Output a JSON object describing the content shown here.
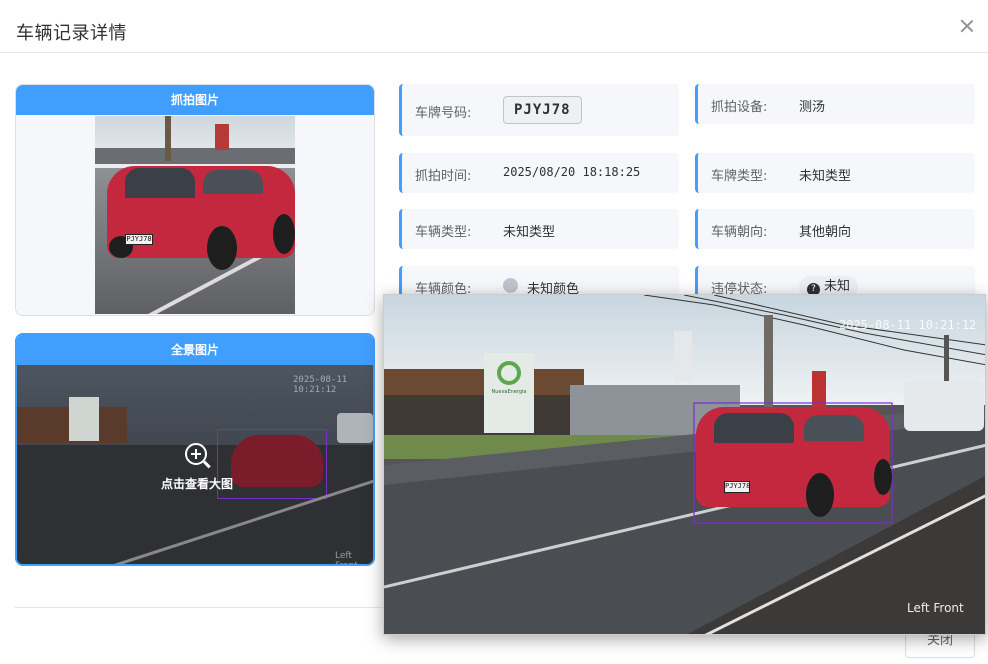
{
  "dialog": {
    "title": "车辆记录详情",
    "close_label": "关闭"
  },
  "capture_card": {
    "title": "抓拍图片",
    "plate_text": "PJYJ78"
  },
  "full_card": {
    "title": "全景图片",
    "zoom_hint": "点击查看大图",
    "timestamp": "2025-08-11 10:21:12",
    "caption": "Left Front"
  },
  "info": {
    "plate": {
      "label": "车牌号码:",
      "value": "PJYJ78"
    },
    "device": {
      "label": "抓拍设备:",
      "value": "测汤"
    },
    "time": {
      "label": "抓拍时间:",
      "value": "2025/08/20 18:18:25"
    },
    "plate_type": {
      "label": "车牌类型:",
      "value": "未知类型"
    },
    "vehicle_type": {
      "label": "车辆类型:",
      "value": "未知类型"
    },
    "direction": {
      "label": "车辆朝向:",
      "value": "其他朝向"
    },
    "color": {
      "label": "车辆颜色:",
      "value": "未知颜色"
    },
    "violation": {
      "label": "违停状态:",
      "value": "未知"
    }
  },
  "preview": {
    "timestamp": "2025-08-11 10:21:12",
    "caption": "Left Front",
    "plate_text": "PJYJ78",
    "billboard_text": "NuevaEnergia"
  },
  "colors": {
    "primary": "#409eff",
    "car": "#c4283e",
    "frame": "#7b2fc9"
  },
  "icons": [
    "close-icon",
    "zoom-in-icon",
    "question-circle-icon",
    "color-swatch-icon"
  ]
}
